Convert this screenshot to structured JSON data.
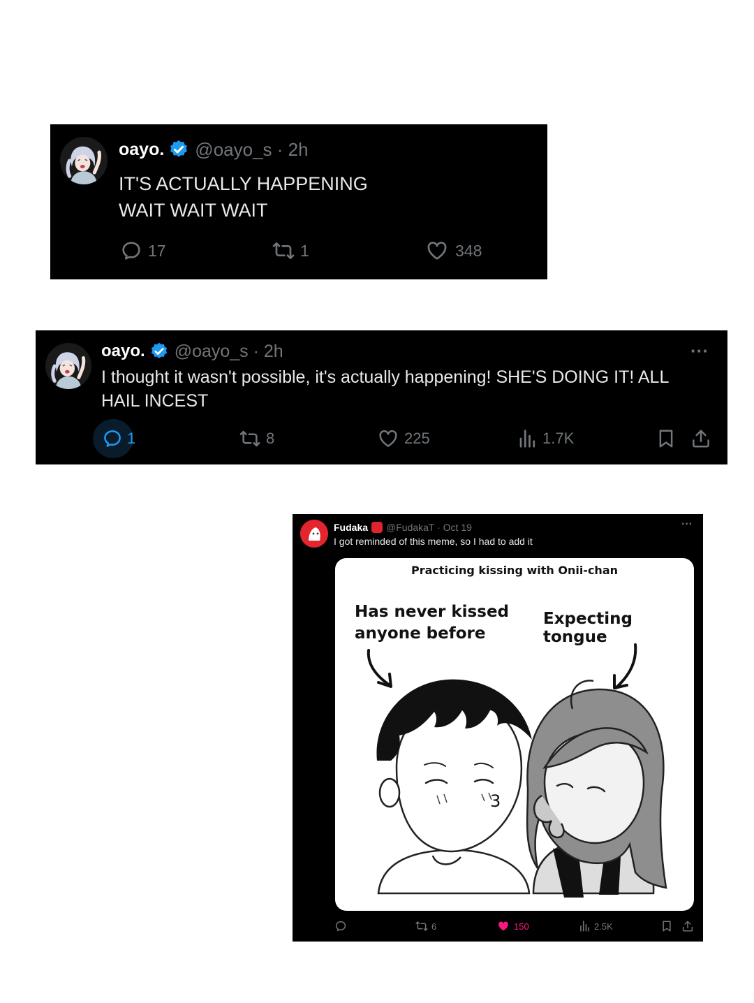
{
  "tweet1": {
    "display_name": "oayo.",
    "handle_time": "@oayo_s · 2h",
    "line1": "IT'S ACTUALLY HAPPENING",
    "line2": "WAIT WAIT WAIT",
    "replies": "17",
    "reposts": "1",
    "likes": "348"
  },
  "tweet2": {
    "display_name": "oayo.",
    "handle_time": "@oayo_s · 2h",
    "more": "···",
    "line1": "I thought it wasn't possible, it's actually happening! SHE'S DOING IT! ALL",
    "line2": "HAIL INCEST",
    "replies": "1",
    "reposts": "8",
    "likes": "225",
    "views": "1.7K",
    "reply_color": "#1d9bf0"
  },
  "tweet3": {
    "display_name": "Fudaka",
    "handle_time": "@FudakaT · Oct 19",
    "more": "···",
    "text": "I got reminded of this meme, so I had to add it",
    "reposts": "6",
    "likes": "150",
    "views": "2.5K",
    "like_color": "#f91880",
    "meme": {
      "title": "Practicing kissing with Onii-chan",
      "left_label_1": "Has never kissed",
      "left_label_2": "anyone before",
      "right_label": "Expecting tongue",
      "kiss_mark": "3"
    }
  },
  "icons": {
    "verified": "verified-badge-icon",
    "reply": "reply-icon",
    "repost": "repost-icon",
    "like": "heart-icon",
    "views": "views-icon",
    "bookmark": "bookmark-icon",
    "share": "share-icon"
  },
  "colors": {
    "verified_blue": "#1d9bf0",
    "tweet_bg": "#000000",
    "muted": "#71767b"
  }
}
